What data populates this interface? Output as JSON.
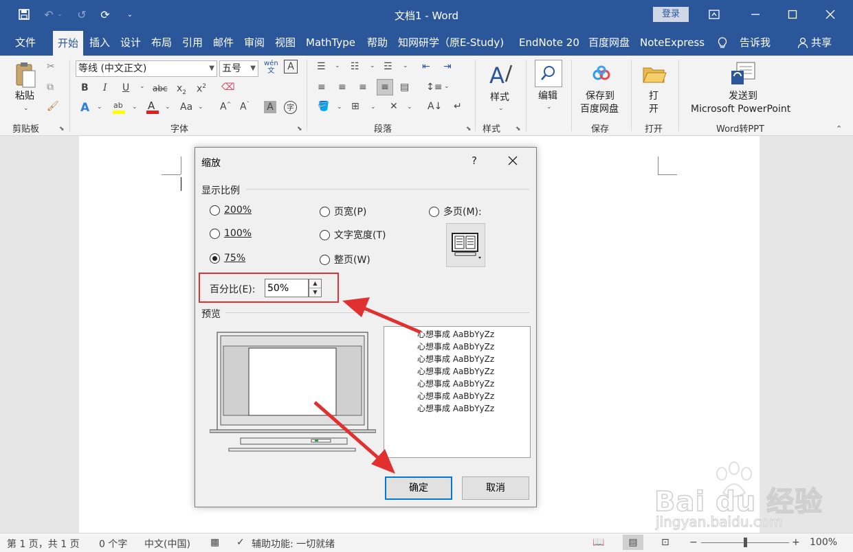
{
  "title_bar": {
    "doc_title": "文档1  -  Word",
    "login_label": "登录"
  },
  "menu": {
    "items": [
      "文件",
      "开始",
      "插入",
      "设计",
      "布局",
      "引用",
      "邮件",
      "审阅",
      "视图",
      "MathType",
      "帮助",
      "知网研学（原E-Study)",
      "EndNote 20",
      "百度网盘",
      "NoteExpress",
      "告诉我",
      "共享"
    ],
    "active": "开始"
  },
  "ribbon": {
    "clipboard": {
      "paste_label": "粘贴",
      "group_label": "剪贴板"
    },
    "font": {
      "font_name": "等线 (中文正文)",
      "font_size": "五号",
      "wen_glyph": "wén\n文",
      "group_label": "字体"
    },
    "paragraph": {
      "group_label": "段落"
    },
    "styles": {
      "label": "样式",
      "group_label": "样式"
    },
    "editing": {
      "label": "编辑"
    },
    "save": {
      "label_line1": "保存到",
      "label_line2": "百度网盘",
      "group_label": "保存"
    },
    "open": {
      "label_line1": "打",
      "label_line2": "开",
      "group_label": "打开"
    },
    "ppt": {
      "label_line1": "发送到",
      "label_line2": "Microsoft PowerPoint",
      "group_label": "Word转PPT"
    }
  },
  "dialog": {
    "title": "缩放",
    "help": "?",
    "zoom_section_label": "显示比例",
    "options": {
      "p200": "200%",
      "p100": "100%",
      "p75": "75%",
      "page_width": "页宽(P)",
      "text_width": "文字宽度(T)",
      "whole_page": "整页(W)",
      "many_pages": "多页(M):"
    },
    "selected_option": "75%",
    "percent_label": "百分比(E):",
    "percent_value": "50%",
    "preview_label": "预览",
    "preview_lines": [
      "心想事成  AaBbYyZz",
      "心想事成  AaBbYyZz",
      "心想事成  AaBbYyZz",
      "心想事成  AaBbYyZz",
      "心想事成  AaBbYyZz",
      "心想事成  AaBbYyZz",
      "心想事成  AaBbYyZz"
    ],
    "ok_label": "确定",
    "cancel_label": "取消"
  },
  "status_bar": {
    "page_info": "第 1 页，共 1 页",
    "word_count": "0 个字",
    "language": "中文(中国)",
    "accessibility": "辅助功能: 一切就绪",
    "zoom_level": "100%",
    "zoom_fraction": 0.5
  },
  "watermark": {
    "brand_line": "Bai du 经验",
    "url": "jingyan.baidu.com"
  },
  "colors": {
    "title_bar": "#2b579a",
    "highlight_box": "#e03030",
    "arrow": "#e03030",
    "default_button_border": "#0078d7"
  }
}
